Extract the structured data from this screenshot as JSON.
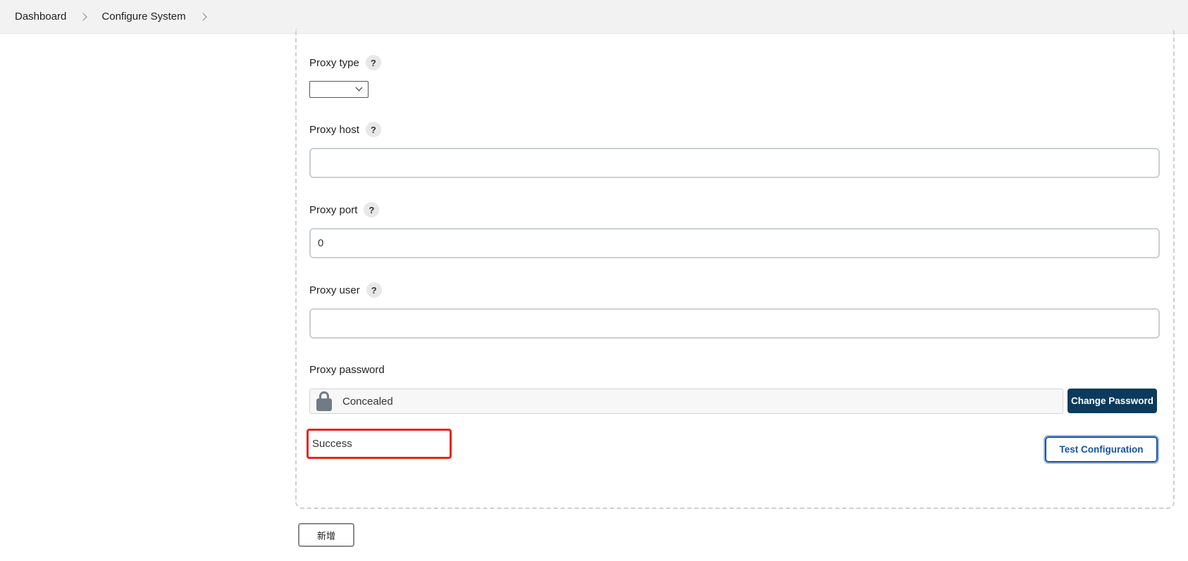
{
  "breadcrumb": {
    "items": [
      "Dashboard",
      "Configure System"
    ]
  },
  "fields": {
    "proxy_type": {
      "label": "Proxy type",
      "selected": ""
    },
    "proxy_host": {
      "label": "Proxy host",
      "value": ""
    },
    "proxy_port": {
      "label": "Proxy port",
      "value": "0"
    },
    "proxy_user": {
      "label": "Proxy user",
      "value": ""
    },
    "proxy_password": {
      "label": "Proxy password",
      "value": "Concealed"
    }
  },
  "buttons": {
    "change_password": "Change Password",
    "test_configuration": "Test Configuration",
    "add": "新增"
  },
  "status": {
    "message": "Success",
    "highlight_color": "#e8261c"
  },
  "icons": {
    "help": "?",
    "lock": "lock-icon",
    "chevron": "chevron-right-icon"
  },
  "colors": {
    "primary_button": "#0b3a5c",
    "outline_button": "#1753a6"
  }
}
